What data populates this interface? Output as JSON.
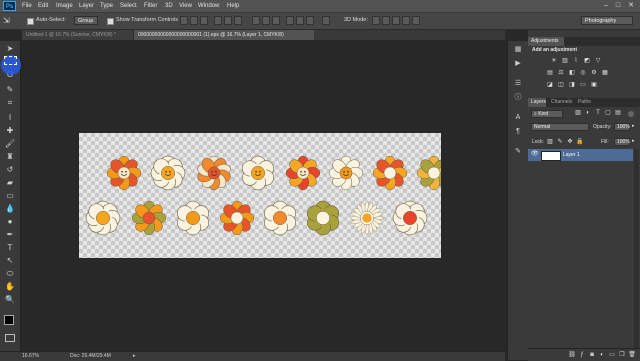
{
  "app": {
    "logo": "Ps"
  },
  "menu": [
    "File",
    "Edit",
    "Image",
    "Layer",
    "Type",
    "Select",
    "Filter",
    "3D",
    "View",
    "Window",
    "Help"
  ],
  "window_controls": {
    "minimize": "–",
    "maximize": "□",
    "close": "✕"
  },
  "options_bar": {
    "auto_select_label": "Auto-Select:",
    "auto_select_value": "Group",
    "show_transform_label": "Show Transform Controls",
    "mode_3d_label": "3D Mode:",
    "workspace": "Photography"
  },
  "doc_tabs": [
    {
      "label": "Untitled-1 @ 16.7% (Sunrise, CMYK/8) *",
      "close": "×"
    },
    {
      "label": "00000000000000000000001 (1).eps @ 16.7% (Layer 1, CMYK/8)",
      "close": "×"
    }
  ],
  "tools": [
    "move",
    "marquee",
    "lasso",
    "quick-select",
    "crop",
    "eyedropper",
    "spot-healing",
    "brush",
    "clone-stamp",
    "history-brush",
    "eraser",
    "gradient",
    "blur",
    "dodge",
    "pen",
    "type",
    "path-select",
    "shape",
    "hand",
    "zoom"
  ],
  "status_bar": {
    "zoom": "16.67%",
    "doc": "Doc: 26.4M/29.4M",
    "arrow": "▸"
  },
  "panels": {
    "adjustments": {
      "tab": "Adjustments",
      "heading": "Add an adjustment"
    },
    "layers_tabs": [
      "Layers",
      "Channels",
      "Paths"
    ],
    "kind_label": "Kind",
    "blend_mode": "Normal",
    "opacity_label": "Opacity:",
    "opacity_value": "100%",
    "lock_label": "Lock:",
    "fill_label": "Fill:",
    "fill_value": "100%",
    "layer_name": "Layer 1"
  },
  "flowers": {
    "row1": [
      {
        "type": "petal",
        "petal": "#f39a1a",
        "alt": "#e8542a",
        "center": "#fbe6c4",
        "smiley": true,
        "count": 8
      },
      {
        "type": "round",
        "petal": "#faf3e0",
        "center": "#f6a520",
        "smiley": true,
        "count": 8
      },
      {
        "type": "petal",
        "petal": "#f7e7c8",
        "alt": "#f28a2d",
        "center": "#e8542a",
        "smiley": true,
        "count": 10
      },
      {
        "type": "round",
        "petal": "#faf3e0",
        "center": "#f6a520",
        "smiley": true,
        "count": 6
      },
      {
        "type": "petal",
        "petal": "#e8432c",
        "alt": "#f5a623",
        "center": "#fbe6c4",
        "smiley": true,
        "count": 8
      },
      {
        "type": "petal",
        "petal": "#faf3e0",
        "alt": "#faf3e0",
        "center": "#f39a1a",
        "smiley": true,
        "count": 8
      },
      {
        "type": "petal",
        "petal": "#f5a623",
        "alt": "#e8542a",
        "center": "#faf3e0",
        "smiley": false,
        "count": 8
      },
      {
        "type": "petal",
        "petal": "#f0b43c",
        "alt": "#a9a23a",
        "center": "#faf3e0",
        "smiley": false,
        "count": 8
      }
    ],
    "row2": [
      {
        "type": "round",
        "petal": "#faf3e0",
        "center": "#f6a520",
        "smiley": false,
        "count": 8
      },
      {
        "type": "petal",
        "petal": "#a9a23a",
        "alt": "#f39a1a",
        "center": "#e8542a",
        "smiley": false,
        "count": 8
      },
      {
        "type": "round",
        "petal": "#faf3e0",
        "center": "#f39a1a",
        "smiley": false,
        "count": 6
      },
      {
        "type": "petal",
        "petal": "#f39a1a",
        "alt": "#e8542a",
        "center": "#faf3e0",
        "smiley": false,
        "count": 8
      },
      {
        "type": "round",
        "petal": "#faf3e0",
        "center": "#f28a2d",
        "smiley": false,
        "count": 6
      },
      {
        "type": "round",
        "petal": "#a9a23a",
        "center": "#faf3e0",
        "smiley": false,
        "count": 6
      },
      {
        "type": "daisy",
        "petal": "#faf3e0",
        "center": "#f6a520",
        "smiley": false,
        "count": 20
      },
      {
        "type": "round",
        "petal": "#faf3e0",
        "center": "#e8432c",
        "smiley": false,
        "count": 8
      }
    ]
  }
}
